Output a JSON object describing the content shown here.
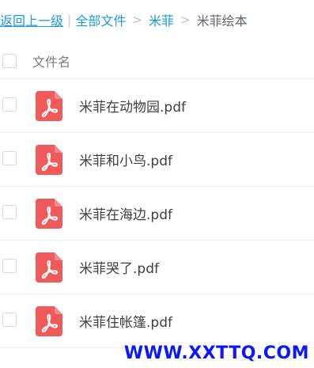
{
  "breadcrumb": {
    "back_label": "返回上一级",
    "separator_bar": "|",
    "all_files_label": "全部文件",
    "folder_label": "米菲",
    "current_label": "米菲绘本",
    "separator": ">"
  },
  "table": {
    "column_name_header": "文件名"
  },
  "files": [
    {
      "name": "米菲在动物园.pdf",
      "type_icon": "pdf-icon"
    },
    {
      "name": "米菲和小鸟.pdf",
      "type_icon": "pdf-icon"
    },
    {
      "name": "米菲在海边.pdf",
      "type_icon": "pdf-icon"
    },
    {
      "name": "米菲哭了.pdf",
      "type_icon": "pdf-icon"
    },
    {
      "name": "米菲住帐篷.pdf",
      "type_icon": "pdf-icon"
    }
  ],
  "colors": {
    "link": "#1a9be0",
    "pdf_icon": "#f05a5a",
    "watermark": "#0a17ff"
  },
  "watermark": "WWW.XXTTQ.COM"
}
